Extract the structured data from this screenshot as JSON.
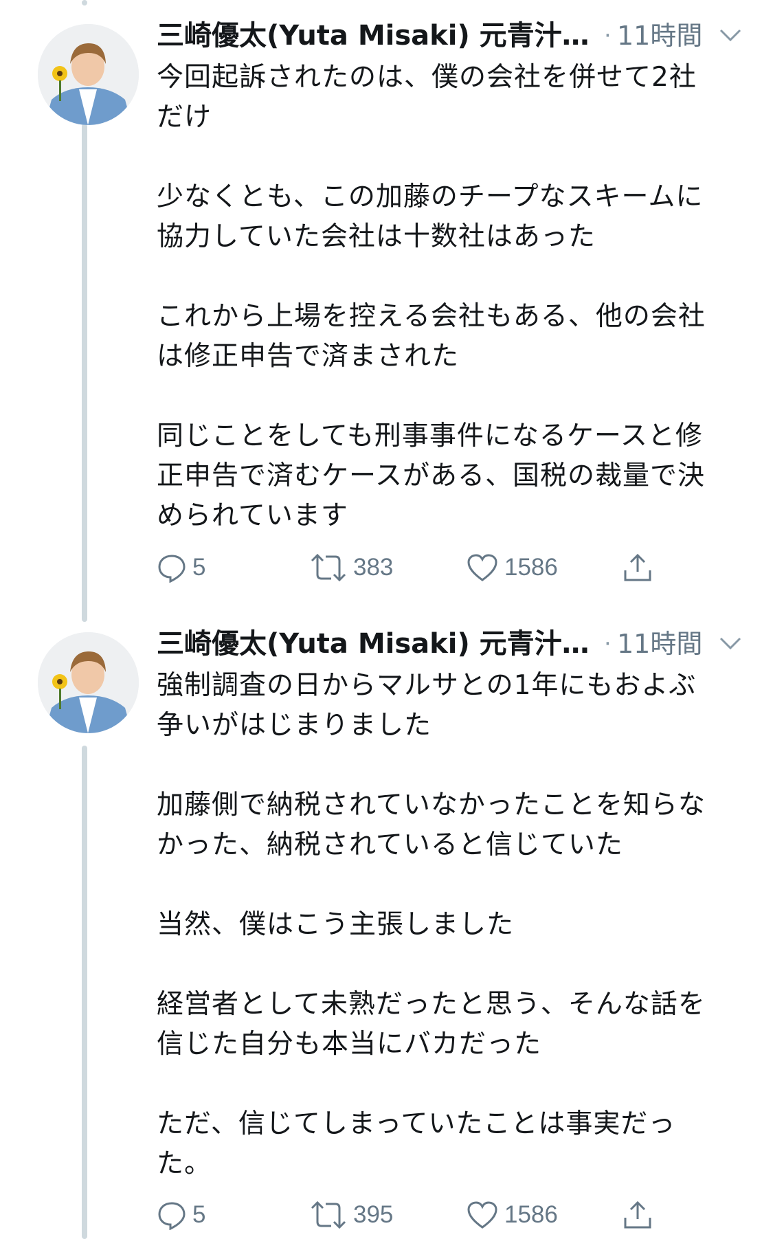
{
  "tweets": [
    {
      "author": "三崎優太(Yuta Misaki) 元青汁…",
      "time": "11時間",
      "paragraphs": [
        "今回起訴されたのは、僕の会社を併せて2社\nだけ",
        "少なくとも、この加藤のチープなスキームに\n協力していた会社は十数社はあった",
        "これから上場を控える会社もある、他の会社\nは修正申告で済まされた",
        "同じことをしても刑事事件になるケースと修\n正申告で済むケースがある、国税の裁量で決\nめられています"
      ],
      "replies": "5",
      "retweets": "383",
      "likes": "1586"
    },
    {
      "author": "三崎優太(Yuta Misaki) 元青汁…",
      "time": "11時間",
      "paragraphs": [
        "強制調査の日からマルサとの1年にもおよぶ\n争いがはじまりました",
        "加藤側で納税されていなかったことを知らな\nかった、納税されていると信じていた",
        "当然、僕はこう主張しました",
        "経営者として未熟だったと思う、そんな話を\n信じた自分も本当にバカだった",
        "ただ、信じてしまっていたことは事実だっ\nた。"
      ],
      "replies": "5",
      "retweets": "395",
      "likes": "1586"
    }
  ],
  "colors": {
    "text": "#14171a",
    "muted": "#657786",
    "thread_line": "#cfd9de",
    "icon": "#657786"
  },
  "icons": [
    "avatar",
    "chevron-down-icon",
    "reply-icon",
    "retweet-icon",
    "like-icon",
    "share-icon"
  ]
}
